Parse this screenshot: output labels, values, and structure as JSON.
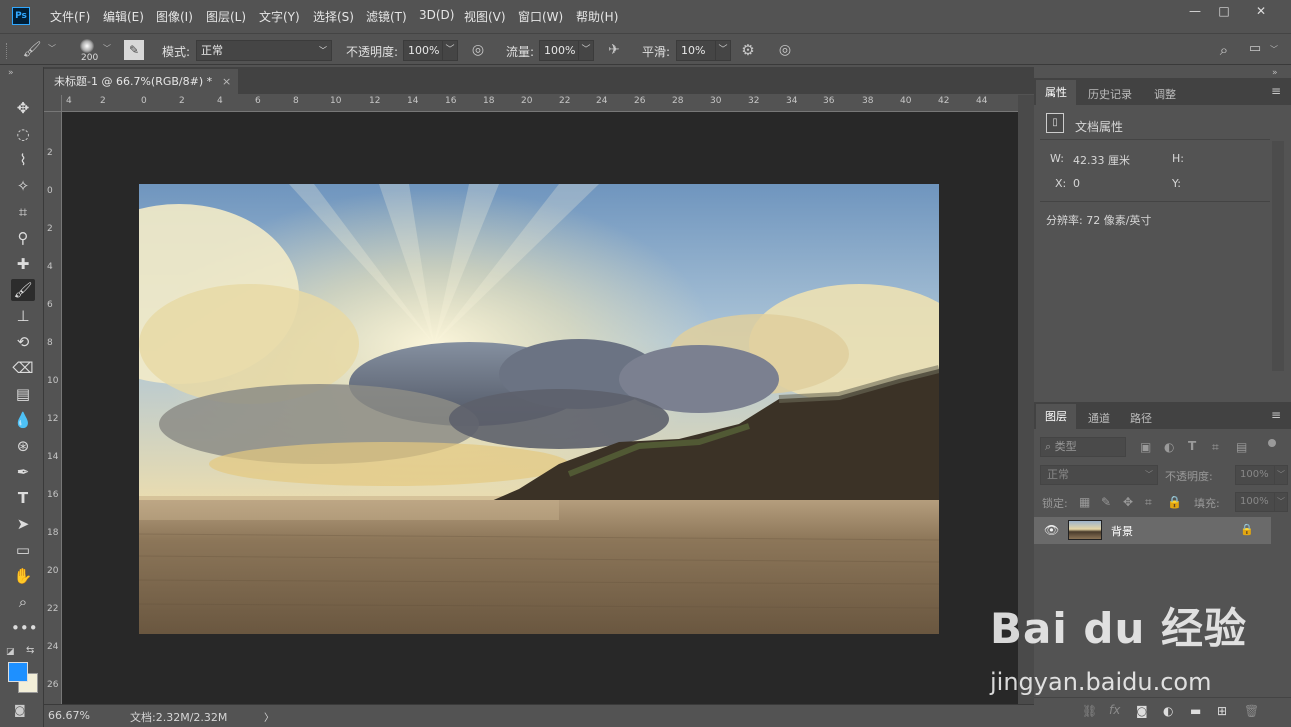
{
  "app": {
    "logo": "Ps"
  },
  "menu": [
    "文件(F)",
    "编辑(E)",
    "图像(I)",
    "图层(L)",
    "文字(Y)",
    "选择(S)",
    "滤镜(T)",
    "3D(D)",
    "视图(V)",
    "窗口(W)",
    "帮助(H)"
  ],
  "options": {
    "brush_size": "200",
    "mode_label": "模式:",
    "mode_value": "正常",
    "opacity_label": "不透明度:",
    "opacity_value": "100%",
    "flow_label": "流量:",
    "flow_value": "100%",
    "smooth_label": "平滑:",
    "smooth_value": "10%"
  },
  "document": {
    "tab_title": "未标题-1 @ 66.7%(RGB/8#) *",
    "close_glyph": "×"
  },
  "ruler": {
    "top_ticks": [
      "4",
      "2",
      "0",
      "2",
      "4",
      "6",
      "8",
      "10",
      "12",
      "14",
      "16",
      "18",
      "20",
      "22",
      "24",
      "26",
      "28",
      "30",
      "32",
      "34",
      "36",
      "38",
      "40",
      "42",
      "44"
    ],
    "left_ticks": [
      "2",
      "0",
      "2",
      "4",
      "6",
      "8",
      "10",
      "12",
      "14",
      "16",
      "18",
      "20",
      "22",
      "24",
      "26"
    ]
  },
  "status": {
    "zoom": "66.67%",
    "doc_size": "文档:2.32M/2.32M",
    "arrow": "〉"
  },
  "properties_panel": {
    "tabs": [
      "属性",
      "历史记录",
      "调整"
    ],
    "section_title": "文档属性",
    "w_label": "W:",
    "w_value": "42.33 厘米",
    "h_label": "H:",
    "x_label": "X:",
    "x_value": "0",
    "y_label": "Y:",
    "resolution": "分辨率: 72 像素/英寸"
  },
  "layers_panel": {
    "tabs": [
      "图层",
      "通道",
      "路径"
    ],
    "filter_kind": "类型",
    "blend_mode": "正常",
    "opacity_label": "不透明度:",
    "opacity_value": "100%",
    "lock_label": "锁定:",
    "fill_label": "填充:",
    "fill_value": "100%",
    "layers": [
      {
        "name": "背景"
      }
    ]
  },
  "watermark": {
    "brand": "Bai du 经验",
    "url": "jingyan.baidu.com"
  },
  "colors": {
    "foreground": "#1e90ff",
    "background": "#f3efd9",
    "ui": "#535353",
    "canvas_bg": "#282828"
  }
}
